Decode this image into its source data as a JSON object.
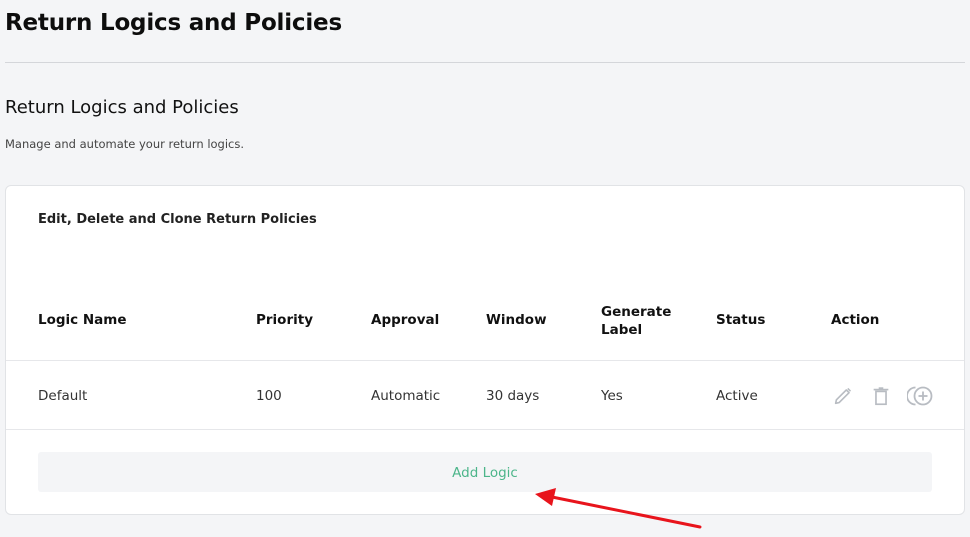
{
  "header": {
    "title": "Return Logics and Policies"
  },
  "section": {
    "title": "Return Logics and Policies",
    "description": "Manage and automate your return logics."
  },
  "card": {
    "title": "Edit, Delete and Clone Return Policies",
    "table": {
      "columns": [
        "Logic Name",
        "Priority",
        "Approval",
        "Window",
        "Generate Label",
        "Status",
        "Action"
      ],
      "rows": [
        {
          "logic_name": "Default",
          "priority": "100",
          "approval": "Automatic",
          "window": "30 days",
          "generate_label": "Yes",
          "status": "Active",
          "actions": [
            "edit-icon",
            "delete-icon",
            "clone-icon"
          ]
        }
      ]
    },
    "add_button_label": "Add Logic"
  },
  "colors": {
    "background": "#f4f5f7",
    "accent": "#4cb58a",
    "annotation": "#e8141c",
    "icon": "#b8bcc2"
  }
}
